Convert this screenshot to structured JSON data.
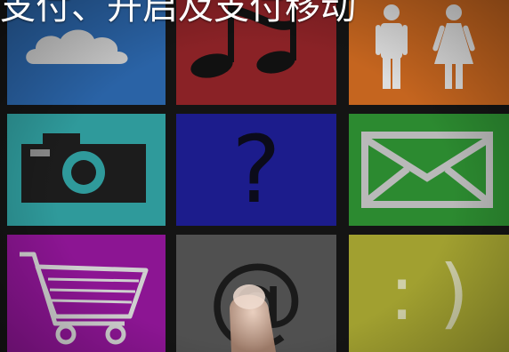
{
  "banner": {
    "text": "支付、开启及支付移动"
  },
  "tiles": [
    {
      "icon": "cloud-icon",
      "color": "#2a63a6"
    },
    {
      "icon": "music-note-icon",
      "color": "#8a2226"
    },
    {
      "icon": "restroom-icon",
      "color": "#c5651f"
    },
    {
      "icon": "camera-icon",
      "color": "#2f9a9b"
    },
    {
      "icon": "question-mark-icon",
      "color": "#1c1c8c",
      "glyph": "?"
    },
    {
      "icon": "envelope-icon",
      "color": "#2c8a30"
    },
    {
      "icon": "shopping-cart-icon",
      "color": "#8c1593"
    },
    {
      "icon": "at-sign-icon",
      "color": "#505050",
      "glyph": "@"
    },
    {
      "icon": "smiley-icon",
      "color": "#a1a030",
      "glyph": ": )"
    }
  ]
}
